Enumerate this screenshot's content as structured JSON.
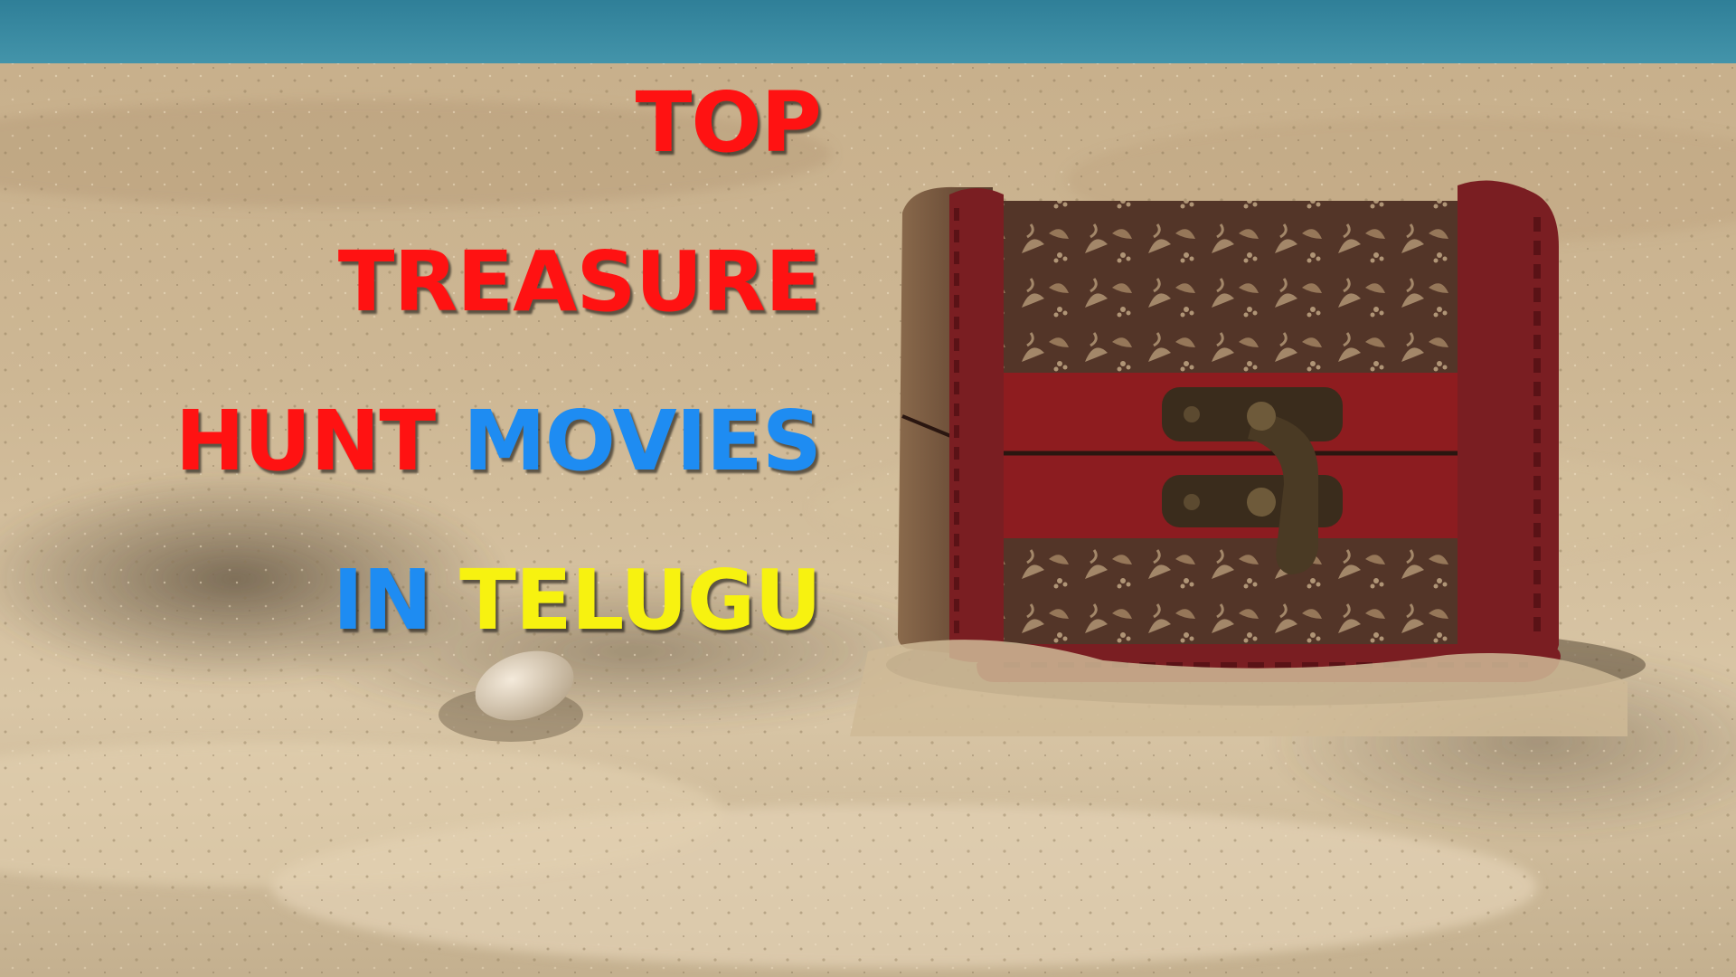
{
  "title": {
    "lines": [
      {
        "words": [
          {
            "text": "TOP",
            "color": "#ff1212"
          }
        ]
      },
      {
        "words": [
          {
            "text": "TREASURE",
            "color": "#ff1212"
          }
        ]
      },
      {
        "words": [
          {
            "text": "HUNT",
            "color": "#ff1212"
          },
          {
            "text": "MOVIES",
            "color": "#1e8cf2"
          }
        ]
      },
      {
        "words": [
          {
            "text": "IN",
            "color": "#1e8cf2"
          },
          {
            "text": "TELUGU",
            "color": "#f7f210"
          }
        ]
      }
    ]
  },
  "palette": {
    "sea": "#3a8fa6",
    "sand_light": "#d8c4a2",
    "sand_dark": "#8d7b60",
    "chest_wood": "#5a3a2c",
    "chest_trim": "#7a1e22",
    "chest_band": "#9b1f22",
    "latch": "#3a2c1c"
  },
  "icons": {
    "chest": "treasure-chest-icon",
    "shell": "seashell-icon"
  }
}
